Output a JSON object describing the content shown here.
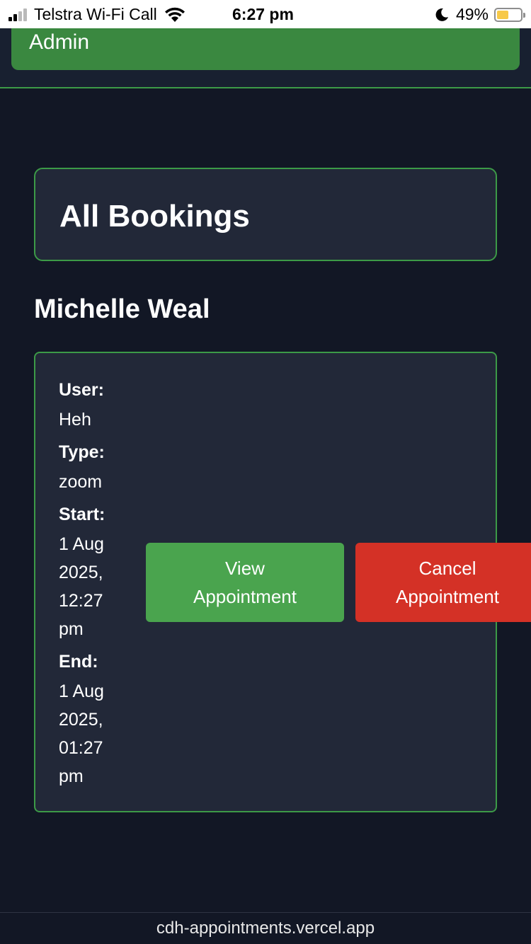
{
  "status_bar": {
    "carrier": "Telstra Wi-Fi Call",
    "time": "6:27 pm",
    "battery_percent": "49%",
    "battery_level": 0.49,
    "icons": [
      "signal-icon",
      "wifi-icon",
      "moon-icon",
      "battery-icon"
    ]
  },
  "header": {
    "admin_label": "Admin",
    "accent_color": "#3a8840"
  },
  "page": {
    "title": "All Bookings",
    "client_name": "Michelle Weal"
  },
  "booking": {
    "user_label": "User:",
    "user_value": "Heh",
    "type_label": "Type:",
    "type_value": "zoom",
    "start_label": "Start:",
    "start_value": "1 Aug 2025, 12:27 pm",
    "end_label": "End:",
    "end_value": "1 Aug 2025, 01:27 pm",
    "view_button": "View Appointment",
    "cancel_button": "Cancel Appointment",
    "view_color": "#4aa44e",
    "cancel_color": "#d43126"
  },
  "browser": {
    "url": "cdh-appointments.vercel.app"
  }
}
